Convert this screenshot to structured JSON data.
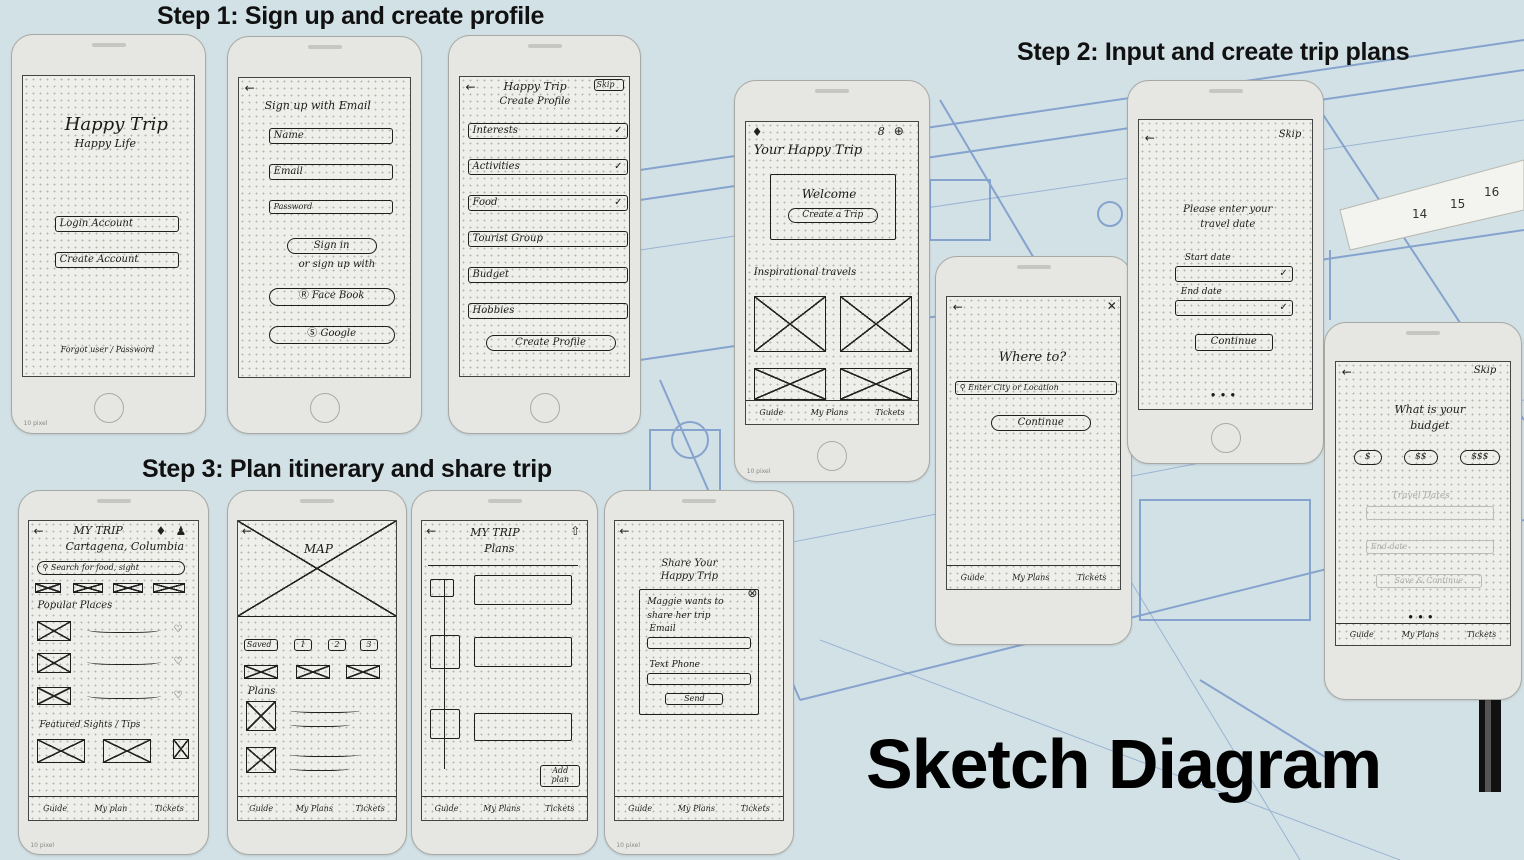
{
  "headings": {
    "step1": "Step 1: Sign up and create profile",
    "step2": "Step 2: Input and create trip plans",
    "step3": "Step 3: Plan itinerary and share trip",
    "main": "Sketch Diagram"
  },
  "common": {
    "pixel_label": "10 pixel",
    "nav": {
      "guide": "Guide",
      "my_plans": "My Plans",
      "my_plan": "My plan",
      "tickets": "Tickets"
    }
  },
  "splash": {
    "title": "Happy Trip",
    "subtitle": "Happy Life",
    "login": "Login Account",
    "create": "Create Account",
    "forgot": "Forgot user / Password"
  },
  "signup": {
    "title": "Sign up with Email",
    "fields": [
      "Name",
      "Email",
      "Password"
    ],
    "sign_in": "Sign in",
    "or": "or sign up with",
    "facebook": "Face Book",
    "google": "Google"
  },
  "profile": {
    "app_title": "Happy Trip",
    "skip": "Skip",
    "subtitle": "Create Profile",
    "fields": [
      "Interests",
      "Activities",
      "Food",
      "Tourist Group",
      "Budget",
      "Hobbies"
    ],
    "button": "Create Profile"
  },
  "home": {
    "title": "Your Happy Trip",
    "welcome": "Welcome",
    "create_trip": "Create a Trip",
    "inspirational": "Inspirational travels",
    "notification_count": "8"
  },
  "where": {
    "title": "Where to?",
    "search": "Enter City or Location",
    "continue": "Continue"
  },
  "dates": {
    "skip": "Skip",
    "title": "Please enter your travel date",
    "start": "Start date",
    "end": "End date",
    "continue": "Continue"
  },
  "budget": {
    "skip": "Skip",
    "title": "What is your budget",
    "options": [
      "$",
      "$$",
      "$$$"
    ],
    "faint_1": "Travel Dates",
    "faint_2": "End date",
    "faint_3": "Save & Continue"
  },
  "trip": {
    "title": "MY TRIP",
    "location": "Cartagena, Columbia",
    "search": "Search for food, sight",
    "popular": "Popular Places",
    "featured": "Featured Sights / Tips"
  },
  "map": {
    "map": "MAP",
    "saved": "Saved",
    "tabs": [
      "1",
      "2",
      "3"
    ],
    "plans": "Plans"
  },
  "plans": {
    "title": "MY TRIP",
    "subtitle": "Plans",
    "add": "Add plan"
  },
  "share": {
    "title": "Share Your Happy Trip",
    "message": "Maggie wants to share her trip",
    "email": "Email",
    "text": "Text Phone",
    "send": "Send"
  }
}
